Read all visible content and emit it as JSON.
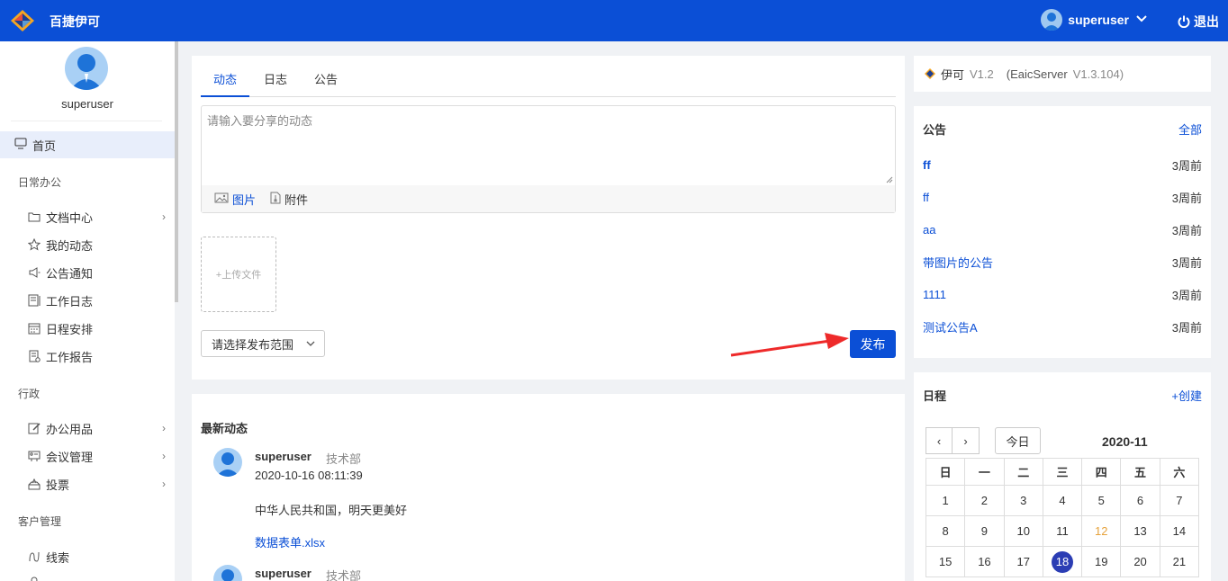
{
  "topbar": {
    "app_name": "百捷伊可",
    "username": "superuser",
    "logout_label": "退出",
    "brand_color": "#0b4fd6"
  },
  "sidebar": {
    "username": "superuser",
    "home_label": "首页",
    "sections": {
      "office": "日常办公",
      "admin": "行政",
      "crm": "客户管理"
    },
    "items": [
      {
        "label": "文档中心",
        "icon": "folder-icon",
        "has_arrow": true
      },
      {
        "label": "我的动态",
        "icon": "star-icon",
        "has_arrow": false
      },
      {
        "label": "公告通知",
        "icon": "speaker-icon",
        "has_arrow": false
      },
      {
        "label": "工作日志",
        "icon": "book-icon",
        "has_arrow": false
      },
      {
        "label": "日程安排",
        "icon": "calendar-icon",
        "has_arrow": false
      },
      {
        "label": "工作报告",
        "icon": "report-icon",
        "has_arrow": false
      },
      {
        "label": "办公用品",
        "icon": "edit-icon",
        "has_arrow": true
      },
      {
        "label": "会议管理",
        "icon": "meeting-icon",
        "has_arrow": true
      },
      {
        "label": "投票",
        "icon": "vote-icon",
        "has_arrow": true
      },
      {
        "label": "线索",
        "icon": "clue-icon",
        "has_arrow": false
      },
      {
        "label": "…",
        "icon": "user-icon",
        "has_arrow": false
      }
    ]
  },
  "composer": {
    "tabs": [
      "动态",
      "日志",
      "公告"
    ],
    "active_tab": 0,
    "placeholder": "请输入要分享的动态",
    "image_label": "图片",
    "attach_label": "附件",
    "upload_label": "+上传文件",
    "scope_label": "请选择发布范围",
    "publish_label": "发布"
  },
  "feed": {
    "title": "最新动态",
    "posts": [
      {
        "author": "superuser",
        "dept": "技术部",
        "time": "2020-10-16 08:11:39",
        "text": "中华人民共和国，明天更美好",
        "file": "数据表单.xlsx"
      },
      {
        "author": "superuser",
        "dept": "技术部",
        "time": "",
        "text": "",
        "file": ""
      }
    ]
  },
  "version": {
    "name": "伊可",
    "version": "V1.2",
    "server": "(EaicServer",
    "server_version": "V1.3.104)"
  },
  "notices": {
    "title": "公告",
    "all_label": "全部",
    "items": [
      {
        "title": "ff",
        "time": "3周前",
        "bold": true
      },
      {
        "title": "ff",
        "time": "3周前",
        "bold": false
      },
      {
        "title": "aa",
        "time": "3周前",
        "bold": false
      },
      {
        "title": "带图片的公告",
        "time": "3周前",
        "bold": false
      },
      {
        "title": "1111",
        "time": "3周前",
        "bold": false
      },
      {
        "title": "测试公告A",
        "time": "3周前",
        "bold": false
      }
    ]
  },
  "schedule": {
    "title": "日程",
    "create_label": "+创建",
    "prev": "‹",
    "next": "›",
    "today_label": "今日",
    "month": "2020-11",
    "weekdays": [
      "日",
      "一",
      "二",
      "三",
      "四",
      "五",
      "六"
    ],
    "weeks": [
      [
        "1",
        "2",
        "3",
        "4",
        "5",
        "6",
        "7"
      ],
      [
        "8",
        "9",
        "10",
        "11",
        "12",
        "13",
        "14"
      ],
      [
        "15",
        "16",
        "17",
        "18",
        "19",
        "20",
        "21"
      ]
    ],
    "today_date": "18",
    "highlight_date": "12",
    "highlight_color": "#e6a23c"
  }
}
